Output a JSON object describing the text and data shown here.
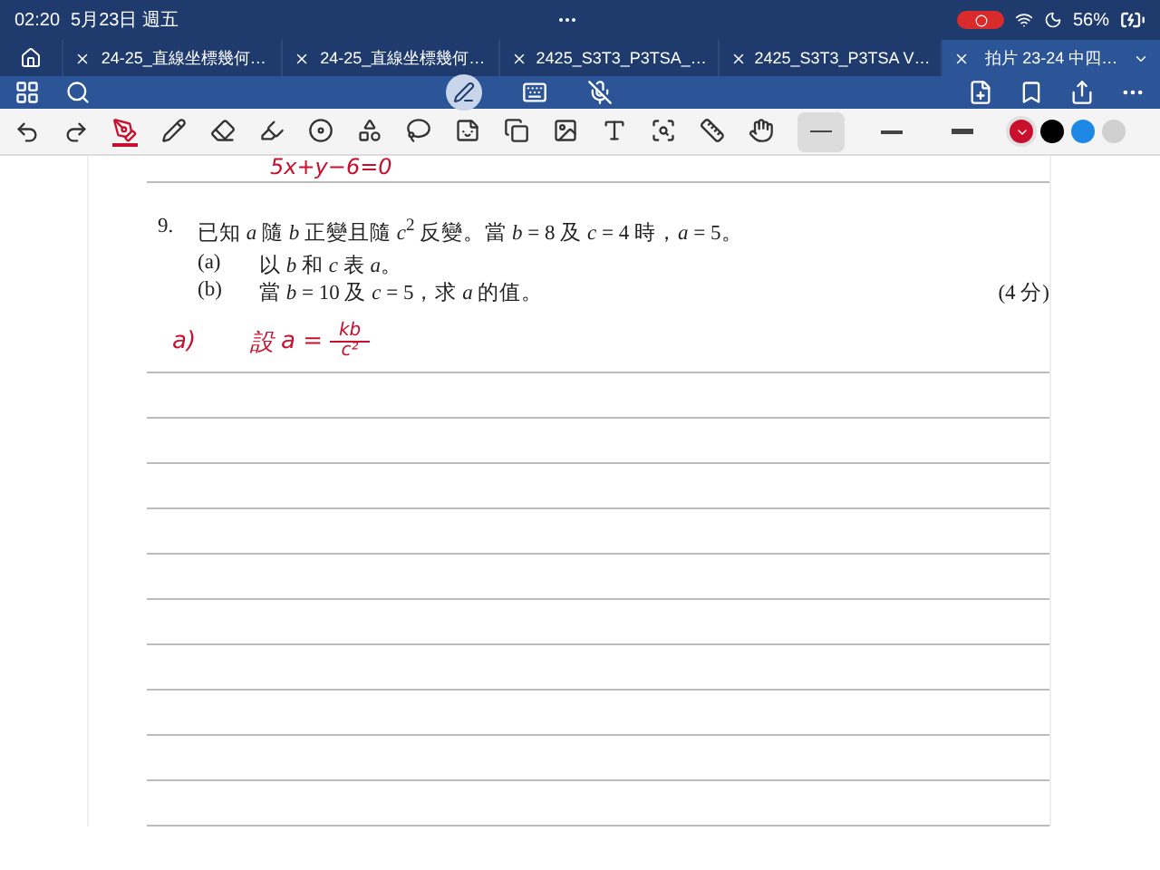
{
  "status_bar": {
    "time": "02:20",
    "date": "5月23日 週五",
    "battery": "56%"
  },
  "tabs": [
    {
      "label": "24-25_直線坐標幾何…",
      "selected": false
    },
    {
      "label": "24-25_直線坐標幾何…",
      "selected": false
    },
    {
      "label": "2425_S3T3_P3TSA_…",
      "selected": false
    },
    {
      "label": "2425_S3T3_P3TSA V…",
      "selected": false
    },
    {
      "label": "拍片 23-24 中四…",
      "selected": true
    }
  ],
  "tools": [
    {
      "selected": true
    },
    {
      "selected": false
    },
    {
      "selected": false
    },
    {
      "selected": false
    },
    {
      "selected": false
    },
    {
      "selected": false
    },
    {
      "selected": false
    },
    {
      "selected": false
    },
    {
      "selected": false
    },
    {
      "selected": false
    },
    {
      "selected": false
    },
    {
      "selected": false
    },
    {
      "selected": false
    },
    {
      "selected": false
    }
  ],
  "strokes": [
    {
      "selected": true
    },
    {
      "selected": false
    },
    {
      "selected": false
    }
  ],
  "colors": [
    {
      "color": "#c8102e",
      "selected": true
    },
    {
      "color": "#000000",
      "selected": false
    },
    {
      "color": "#1e88e5",
      "selected": false
    },
    {
      "color": "#d0d0d0",
      "selected": false
    }
  ],
  "document": {
    "ink_top": "5x+y−6=0",
    "question": {
      "number": "9.",
      "stem": "已知 *a* 隨 *b* 正變且隨 *c*$^{2}$ 反變。當 *b* = 8 及 *c* = 4 時，*a* = 5。",
      "parts": [
        {
          "label": "(a)",
          "text": "以 *b* 和 *c* 表 *a*。"
        },
        {
          "label": "(b)",
          "text": "當 *b* = 10 及 *c* = 5，求 *a* 的值。",
          "marks": "(4 分)"
        }
      ]
    },
    "ink_answer": {
      "label": "a)",
      "word": "設",
      "lhs": "a =",
      "numerator": "kb",
      "denominator": "c²"
    }
  }
}
